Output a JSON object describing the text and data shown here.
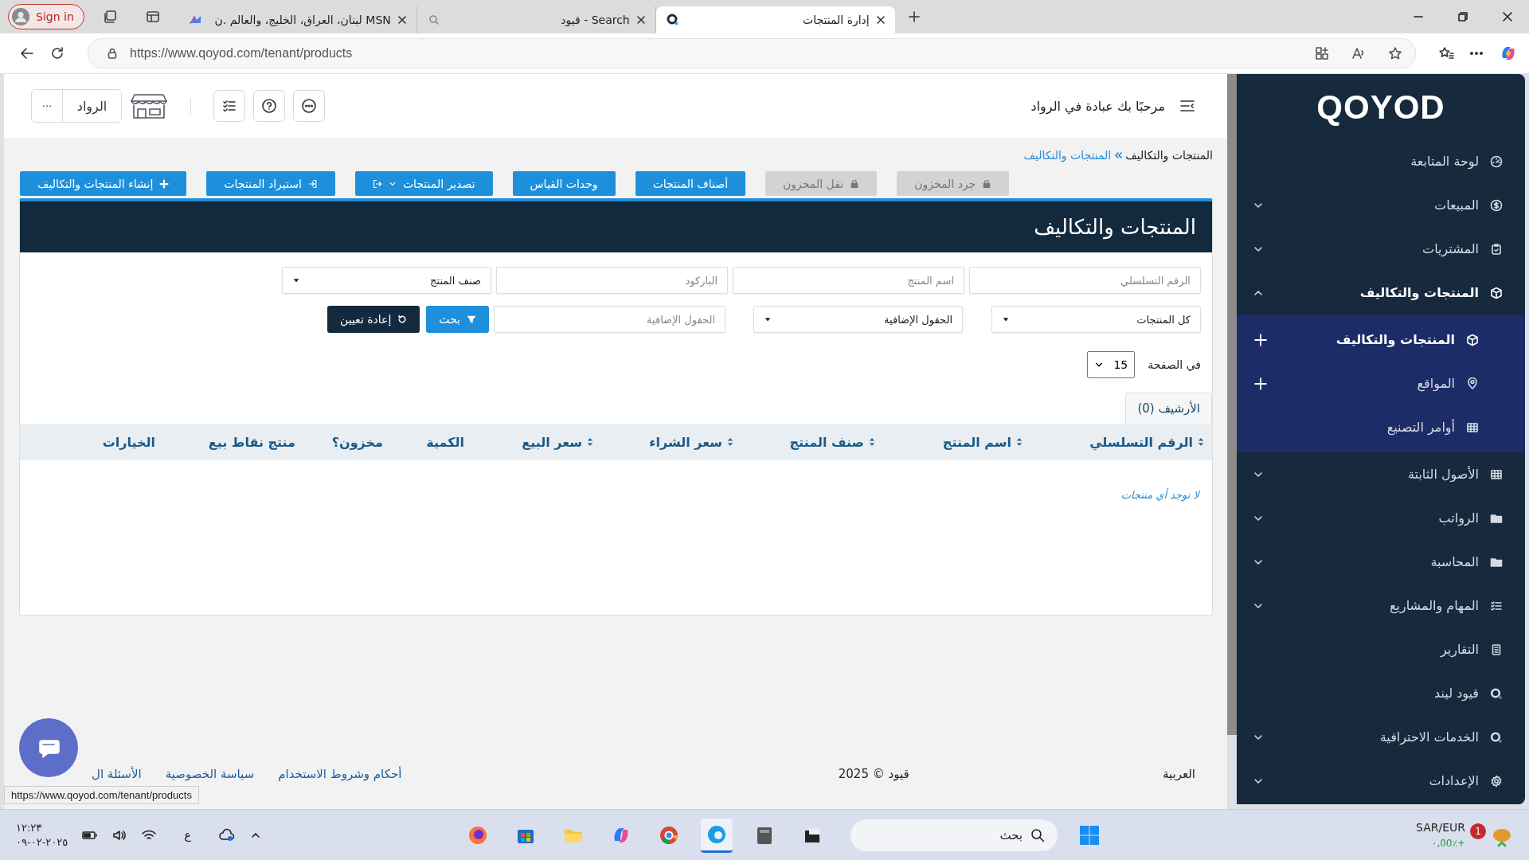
{
  "browser": {
    "sign_in": "Sign in",
    "tabs": [
      {
        "title": "إدارة المنتجات",
        "selected": true
      },
      {
        "title": "قيود - Search",
        "selected": false
      },
      {
        "title": "MSN لبنان، العراق، الخليج، والعالم .ن",
        "selected": false
      }
    ],
    "url": "https://www.qoyod.com/tenant/products"
  },
  "header": {
    "greeting": "مرحبًا بك عبادة في الرواد",
    "company": "الرواد",
    "more": "···"
  },
  "sidebar": {
    "logo": "QOYOD",
    "items": [
      {
        "label": "لوحة المتابعة",
        "expandable": false,
        "expanded": false
      },
      {
        "label": "المبيعات",
        "expandable": true,
        "expanded": false
      },
      {
        "label": "المشتريات",
        "expandable": true,
        "expanded": false
      },
      {
        "label": "المنتجات والتكاليف",
        "expandable": true,
        "expanded": true,
        "children": [
          {
            "label": "المنتجات والتكاليف",
            "selected": true,
            "add": true
          },
          {
            "label": "المواقع",
            "selected": false,
            "add": true
          },
          {
            "label": "أوامر التصنيع",
            "selected": false,
            "add": false
          }
        ]
      },
      {
        "label": "الأصول الثابتة",
        "expandable": true,
        "expanded": false
      },
      {
        "label": "الرواتب",
        "expandable": true,
        "expanded": false
      },
      {
        "label": "المحاسبة",
        "expandable": true,
        "expanded": false
      },
      {
        "label": "المهام والمشاريع",
        "expandable": true,
        "expanded": false
      },
      {
        "label": "التقارير",
        "expandable": false,
        "expanded": false
      },
      {
        "label": "قيود ليند",
        "expandable": false,
        "expanded": false
      },
      {
        "label": "الخدمات الاحترافية",
        "expandable": true,
        "expanded": false
      },
      {
        "label": "الإعدادات",
        "expandable": true,
        "expanded": false
      }
    ]
  },
  "breadcrumb": [
    {
      "label": "المنتجات والتكاليف",
      "link": false
    },
    {
      "label": "المنتجات والتكاليف",
      "link": true
    }
  ],
  "actions": [
    {
      "label": "جرد المخزون",
      "disabled": true,
      "kind": "lock"
    },
    {
      "label": "نقل المخزون",
      "disabled": true,
      "kind": "lock"
    },
    {
      "label": "أصناف المنتجات",
      "disabled": false,
      "kind": "plain"
    },
    {
      "label": "وحدات القياس",
      "disabled": false,
      "kind": "plain"
    },
    {
      "label": "تصدير المنتجات",
      "disabled": false,
      "kind": "export"
    },
    {
      "label": "استيراد المنتجات",
      "disabled": false,
      "kind": "import"
    },
    {
      "label": "إنشاء المنتجات والتكاليف",
      "disabled": false,
      "kind": "create"
    }
  ],
  "panel": {
    "title": "المنتجات والتكاليف",
    "filters": [
      [
        {
          "kind": "input",
          "placeholder": "الرقم التسلسلي"
        },
        {
          "kind": "input",
          "placeholder": "اسم المنتج"
        },
        {
          "kind": "input",
          "placeholder": "الباركود"
        },
        {
          "kind": "select",
          "value": "صنف المنتج"
        }
      ],
      [
        {
          "kind": "select",
          "value": "كل المنتجات"
        },
        {
          "kind": "select",
          "value": "الحقول الإضافية"
        },
        {
          "kind": "input",
          "placeholder": "الحقول الإضافية"
        },
        {
          "kind": "search",
          "label": "بحث"
        },
        {
          "kind": "reset",
          "label": "إعادة تعيين"
        }
      ]
    ],
    "per_page": {
      "label": "في الصفحة",
      "value": "15"
    },
    "archive_tab": "الأرشيف (0)",
    "columns": [
      {
        "label": "الرقم التسلسلي",
        "sortable": true
      },
      {
        "label": "اسم المنتج",
        "sortable": true
      },
      {
        "label": "صنف المنتج",
        "sortable": true
      },
      {
        "label": "سعر الشراء",
        "sortable": true
      },
      {
        "label": "سعر البيع",
        "sortable": true
      },
      {
        "label": "الكمية",
        "sortable": false
      },
      {
        "label": "مخزون؟",
        "sortable": false
      },
      {
        "label": "منتج نقاط بيع",
        "sortable": false
      },
      {
        "label": "الخيارات",
        "sortable": false
      }
    ],
    "empty": "لا توجد أي منتجات"
  },
  "footer": {
    "language": "العربية",
    "copyright": "قيود © 2025",
    "links": [
      "أحكام وشروط الاستخدام",
      "سياسة الخصوصية",
      "الأسئلة ال"
    ]
  },
  "status_url": "https://www.qoyod.com/tenant/products",
  "taskbar": {
    "time": "١٢:٢٣",
    "date": "٢٠٢٥-٠٢-٠٩",
    "input_language": "ع",
    "search_placeholder": "بحث",
    "ticker": "SAR/EUR",
    "ticker_change": "٠,00٪+",
    "notification_count": "1"
  }
}
